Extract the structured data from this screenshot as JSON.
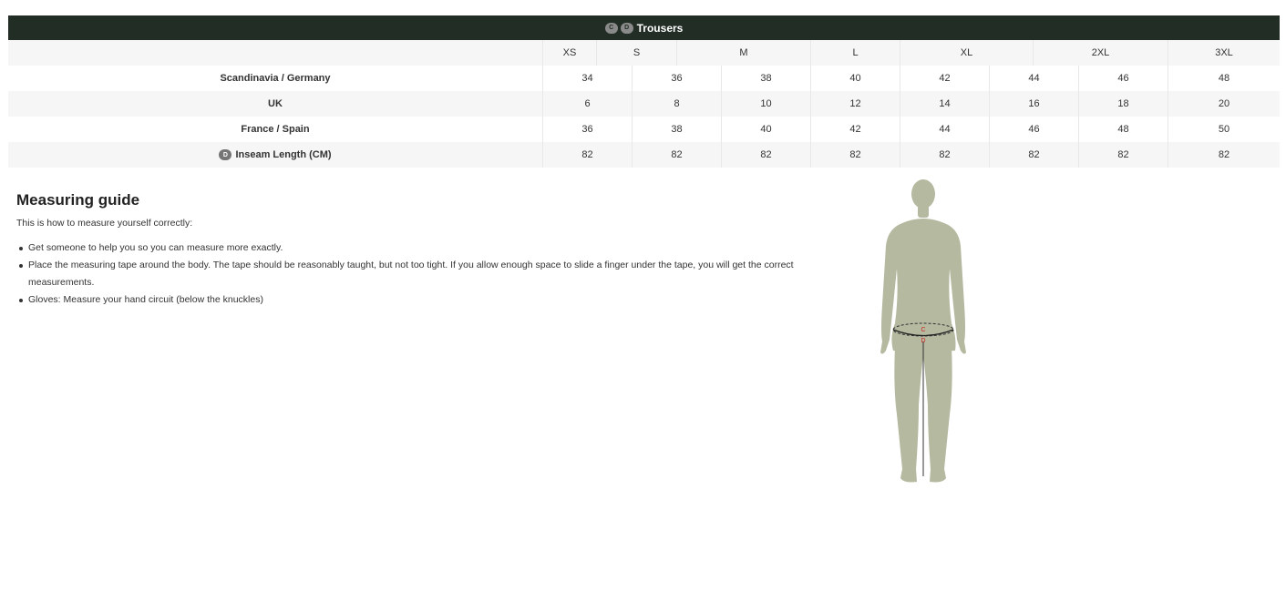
{
  "table": {
    "title": "Trousers",
    "header_badges": [
      "C",
      "D"
    ],
    "sizes": [
      "XS",
      "S",
      "M",
      "L",
      "XL",
      "2XL",
      "3XL"
    ],
    "rows": [
      {
        "label": "Scandinavia / Germany",
        "badge": "",
        "values": [
          "34",
          "36",
          "38",
          "40",
          "42",
          "44",
          "46",
          "48"
        ]
      },
      {
        "label": "UK",
        "badge": "",
        "values": [
          "6",
          "8",
          "10",
          "12",
          "14",
          "16",
          "18",
          "20"
        ]
      },
      {
        "label": "France / Spain",
        "badge": "",
        "values": [
          "36",
          "38",
          "40",
          "42",
          "44",
          "46",
          "48",
          "50"
        ]
      },
      {
        "label": "Inseam Length (CM)",
        "badge": "D",
        "values": [
          "82",
          "82",
          "82",
          "82",
          "82",
          "82",
          "82",
          "82"
        ]
      }
    ]
  },
  "guide": {
    "title": "Measuring guide",
    "intro": "This is how to measure yourself correctly:",
    "items": [
      "Get someone to help you so you can measure more exactly.",
      "Place the measuring tape around the body. The tape should be reasonably taught, but not too tight. If you allow enough space to slide a finger under the tape, you will get the correct measurements.",
      "Gloves: Measure your hand circuit (below the knuckles)"
    ]
  },
  "figure": {
    "markers": [
      "C",
      "D"
    ],
    "body_color": "#b5b9a0",
    "marker_color": "#cc2222"
  },
  "colors": {
    "header_bg": "#222d25",
    "row_alt_bg": "#f6f6f6",
    "badge_bg": "#757575"
  }
}
